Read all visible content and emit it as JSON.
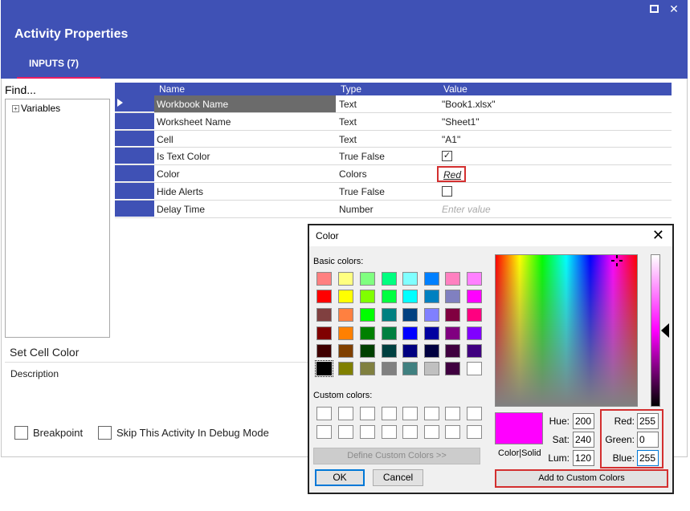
{
  "window": {
    "title": "Activity Properties",
    "tab_label": "INPUTS (7)",
    "maximize_icon": "maximize-icon",
    "close_icon": "close-icon",
    "header_color": "#3f51b5",
    "tab_underline_color": "#e91e63"
  },
  "left": {
    "find_label": "Find...",
    "tree": [
      {
        "label": "Variables",
        "icon": "expand-plus-icon"
      }
    ]
  },
  "grid": {
    "headers": {
      "name": "Name",
      "type": "Type",
      "value": "Value"
    },
    "rows": [
      {
        "name": "Workbook Name",
        "type": "Text",
        "value": "\"Book1.xlsx\""
      },
      {
        "name": "Worksheet Name",
        "type": "Text",
        "value": "\"Sheet1\""
      },
      {
        "name": "Cell",
        "type": "Text",
        "value": "\"A1\""
      },
      {
        "name": "Is Text Color",
        "type": "True False",
        "checked": true
      },
      {
        "name": "Color",
        "type": "Colors",
        "value": "Red"
      },
      {
        "name": "Hide Alerts",
        "type": "True False",
        "checked": false
      },
      {
        "name": "Delay Time",
        "type": "Number",
        "placeholder": "Enter value"
      }
    ]
  },
  "bottom": {
    "activity_title": "Set Cell Color",
    "description_label": "Description",
    "breakpoint_label": "Breakpoint",
    "skip_label": "Skip This Activity In Debug Mode"
  },
  "color_dialog": {
    "title": "Color",
    "basic_colors_label": "Basic colors:",
    "custom_colors_label": "Custom colors:",
    "basic_colors": [
      [
        "#ff8080",
        "#ffff80",
        "#80ff80",
        "#00ff80",
        "#80ffff",
        "#0080ff",
        "#ff80c0",
        "#ff80ff"
      ],
      [
        "#ff0000",
        "#ffff00",
        "#80ff00",
        "#00ff40",
        "#00ffff",
        "#0080c0",
        "#8080c0",
        "#ff00ff"
      ],
      [
        "#804040",
        "#ff8040",
        "#00ff00",
        "#008080",
        "#004080",
        "#8080ff",
        "#800040",
        "#ff0080"
      ],
      [
        "#800000",
        "#ff8000",
        "#008000",
        "#008040",
        "#0000ff",
        "#0000a0",
        "#800080",
        "#8000ff"
      ],
      [
        "#400000",
        "#804000",
        "#004000",
        "#004040",
        "#000080",
        "#000040",
        "#400040",
        "#400080"
      ],
      [
        "#000000",
        "#808000",
        "#808040",
        "#808080",
        "#408080",
        "#c0c0c0",
        "#400040",
        "#ffffff"
      ]
    ],
    "define_button": "Define Custom Colors >>",
    "ok_button": "OK",
    "cancel_button": "Cancel",
    "preview_label": "Color|Solid",
    "preview_color": "#ff00ff",
    "hue_label": "Hue:",
    "hue": "200",
    "sat_label": "Sat:",
    "sat": "240",
    "lum_label": "Lum:",
    "lum": "120",
    "red_label": "Red:",
    "red": "255",
    "green_label": "Green:",
    "green": "0",
    "blue_label": "Blue:",
    "blue": "255",
    "add_button": "Add to Custom Colors",
    "highlight_color": "#d32f2f"
  }
}
